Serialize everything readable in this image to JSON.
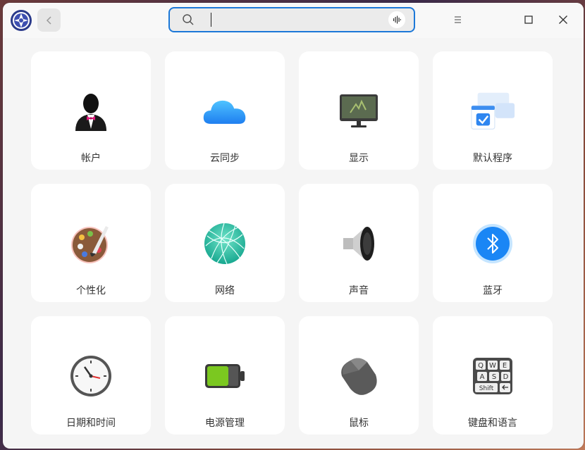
{
  "search": {
    "value": "",
    "placeholder": ""
  },
  "cards": [
    {
      "label": "帐户",
      "icon": "account-icon"
    },
    {
      "label": "云同步",
      "icon": "cloud-icon"
    },
    {
      "label": "显示",
      "icon": "display-icon"
    },
    {
      "label": "默认程序",
      "icon": "default-apps-icon"
    },
    {
      "label": "个性化",
      "icon": "palette-icon"
    },
    {
      "label": "网络",
      "icon": "network-globe-icon"
    },
    {
      "label": "声音",
      "icon": "speaker-icon"
    },
    {
      "label": "蓝牙",
      "icon": "bluetooth-icon"
    },
    {
      "label": "日期和时间",
      "icon": "clock-icon"
    },
    {
      "label": "电源管理",
      "icon": "battery-icon"
    },
    {
      "label": "鼠标",
      "icon": "mouse-icon"
    },
    {
      "label": "键盘和语言",
      "icon": "keyboard-icon"
    }
  ],
  "keyboard_keys": [
    "Q",
    "W",
    "E",
    "A",
    "S",
    "D",
    "Shift"
  ],
  "accent_color": "#1c78d8"
}
